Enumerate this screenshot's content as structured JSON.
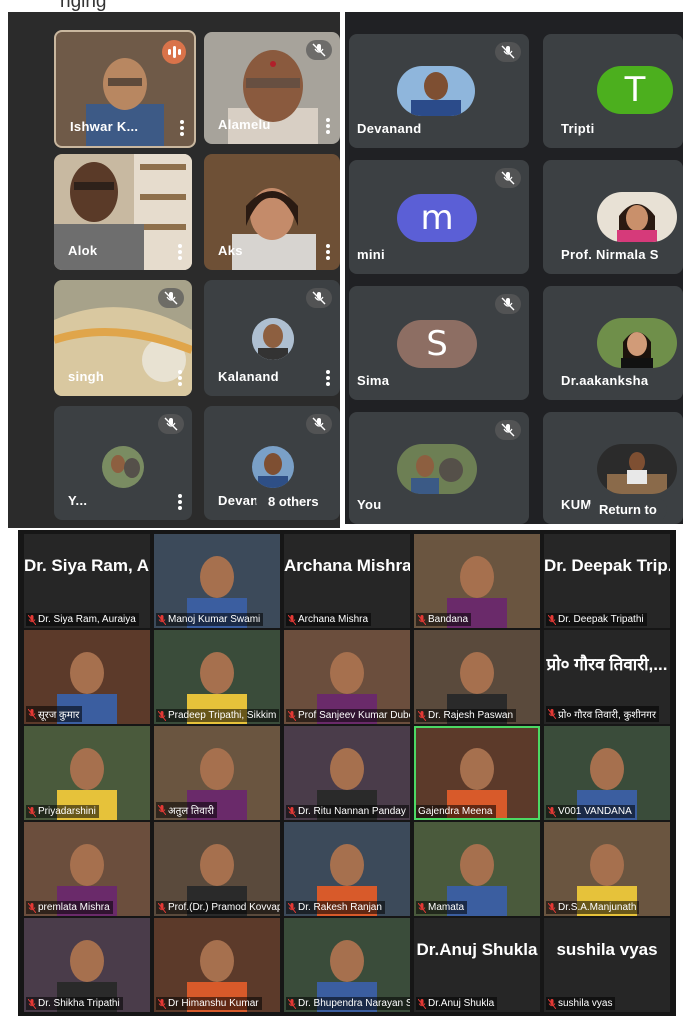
{
  "top_strip_text": "nging",
  "meet_left": {
    "tiles": [
      {
        "name": "Ishwar K...",
        "speaking": true
      },
      {
        "name": "Alamelu",
        "muted": true
      },
      {
        "name": "Alok"
      },
      {
        "name": "Aks"
      },
      {
        "name": "singh",
        "muted": true
      },
      {
        "name": "Kalanand",
        "muted": true
      },
      {
        "name": "Y...",
        "muted": true
      },
      {
        "name": "Devan",
        "muted": true
      }
    ],
    "others_label": "8 others"
  },
  "meet_right": {
    "tiles": [
      {
        "name": "Devanand",
        "muted": true,
        "avatar": "photo"
      },
      {
        "name": "Tripti",
        "avatar": "T",
        "avatar_color": "#4caf1e"
      },
      {
        "name": "mini",
        "muted": true,
        "avatar": "m",
        "avatar_color": "#5b5fd6"
      },
      {
        "name": "Prof. Nirmala S",
        "avatar": "photo"
      },
      {
        "name": "Sima",
        "muted": true,
        "avatar": "S",
        "avatar_color": "#8d6e63"
      },
      {
        "name": "Dr.aakanksha",
        "avatar": "photo"
      },
      {
        "name": "You",
        "muted": true,
        "avatar": "photo"
      },
      {
        "name": "KUM",
        "avatar": "photo"
      }
    ],
    "return_label": "Return to"
  },
  "zoom_gallery": {
    "rows": [
      [
        {
          "label": "Dr. Siya Ram, Auraiya",
          "title": "Dr. Siya Ram, A..."
        },
        {
          "label": "Manoj Kumar Swami"
        },
        {
          "label": "Archana Mishra",
          "title": "Archana Mishra"
        },
        {
          "label": "Bandana"
        },
        {
          "label": "Dr. Deepak Tripathi",
          "title": "Dr. Deepak Trip..."
        }
      ],
      [
        {
          "label": "सूरज कुमार"
        },
        {
          "label": "Pradeep Tripathi, Sikkim"
        },
        {
          "label": "Prof Sanjeev Kumar Dubey"
        },
        {
          "label": "Dr. Rajesh Paswan"
        },
        {
          "label": "प्रो० गौरव तिवारी, कुशीनगर",
          "title": "प्रो० गौरव तिवारी,..."
        }
      ],
      [
        {
          "label": "Priyadarshini"
        },
        {
          "label": "अतुल तिवारी"
        },
        {
          "label": "Dr. Ritu Nannan Panday"
        },
        {
          "label": "Gajendra Meena",
          "active": true,
          "muted": false
        },
        {
          "label": "V001 VANDANA"
        }
      ],
      [
        {
          "label": "premlata Mishra"
        },
        {
          "label": "Prof.(Dr.) Pramod Kovvaprath"
        },
        {
          "label": "Dr. Rakesh Ranjan"
        },
        {
          "label": "Mamata"
        },
        {
          "label": "Dr.S.A.Manjunath"
        }
      ],
      [
        {
          "label": "Dr. Shikha Tripathi"
        },
        {
          "label": "Dr Himanshu Kumar"
        },
        {
          "label": "Dr. Bhupendra Narayan Sinha"
        },
        {
          "label": "Dr.Anuj Shukla",
          "title": "Dr.Anuj Shukla"
        },
        {
          "label": "sushila vyas",
          "title": "sushila vyas"
        }
      ]
    ]
  }
}
